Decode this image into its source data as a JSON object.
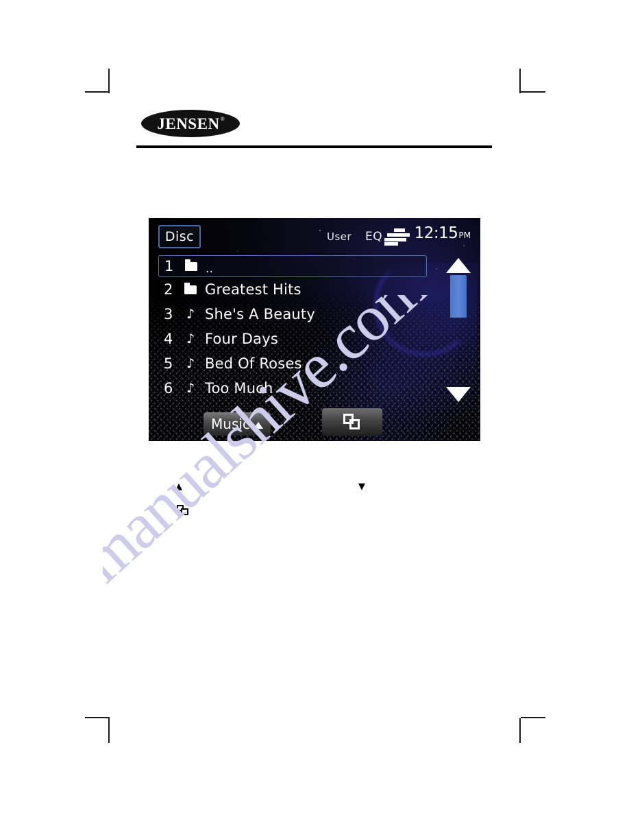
{
  "brand": {
    "name": "JENSEN",
    "registered_mark": "®"
  },
  "device_screen": {
    "status_bar": {
      "source_button_label": "Disc",
      "user_label": "User",
      "eq_label": "EQ",
      "eq_icon": "equalizer-bars-icon",
      "clock_time": "12:15",
      "clock_meridiem": "PM"
    },
    "browser_list": {
      "rows": [
        {
          "number": "1",
          "icon": "folder-icon",
          "label": ".."
        },
        {
          "number": "2",
          "icon": "folder-icon",
          "label": "Greatest Hits"
        },
        {
          "number": "3",
          "icon": "music-note-icon",
          "label": "She's A Beauty"
        },
        {
          "number": "4",
          "icon": "music-note-icon",
          "label": "Four Days"
        },
        {
          "number": "5",
          "icon": "music-note-icon",
          "label": "Bed Of Roses"
        },
        {
          "number": "6",
          "icon": "music-note-icon",
          "label": "Too Much"
        }
      ],
      "selected_index": 0
    },
    "scrollbar": {
      "up_arrow_icon": "triangle-up-icon",
      "down_arrow_icon": "triangle-down-icon",
      "thumb_color": "#4a78c9"
    },
    "bottom_bar": {
      "music_button_label": "Music",
      "music_button_caret_icon": "triangle-up-icon",
      "copy_button_icon": "copy-overlapping-squares-icon"
    },
    "colors": {
      "accent_blue": "#4a78c9",
      "selection_border": "#4f6fae",
      "disc_button_border": "#4c6a9e",
      "screen_background": "#000000",
      "text": "#ffffff"
    }
  },
  "caption_glyphs": {
    "up_arrow": "▲",
    "down_arrow": "▼",
    "copy_icon": "copy-overlapping-squares-icon"
  },
  "watermark": {
    "text": "manualshive.com",
    "color": "#cdcdeb"
  }
}
